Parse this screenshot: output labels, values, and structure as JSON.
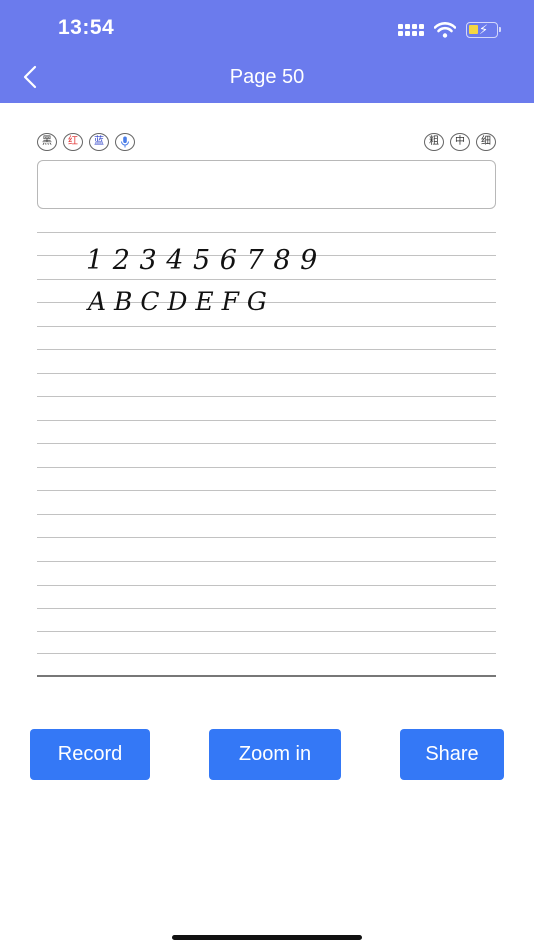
{
  "status_bar": {
    "time": "13:54"
  },
  "header": {
    "title": "Page 50"
  },
  "colors": {
    "header": "#6b7bed",
    "button": "#3478f6",
    "red": "#e23b3b",
    "blue": "#2f43c9"
  },
  "tools": {
    "colors": [
      {
        "label": "黑",
        "color": "#222222"
      },
      {
        "label": "红",
        "color": "#e23b3b"
      },
      {
        "label": "蓝",
        "color": "#2f43c9"
      }
    ],
    "mic_icon": "microphone-icon",
    "thickness": [
      {
        "label": "粗"
      },
      {
        "label": "中"
      },
      {
        "label": "细"
      }
    ]
  },
  "text_input": {
    "value": "",
    "placeholder": ""
  },
  "handwriting": {
    "line1": "1 2 3 4 5 6 7 8 9",
    "line2": "A B C D E F G"
  },
  "buttons": {
    "record": "Record",
    "zoom_in": "Zoom in",
    "share": "Share"
  }
}
